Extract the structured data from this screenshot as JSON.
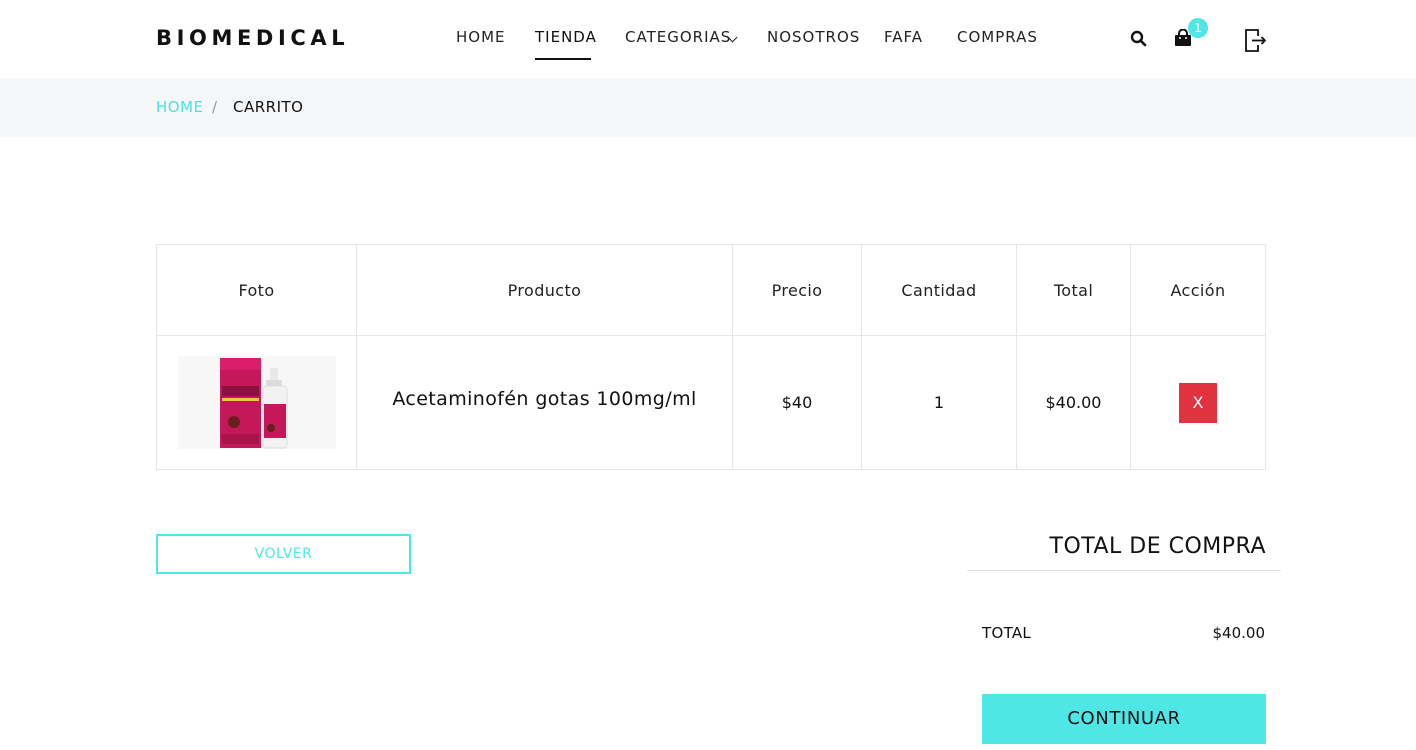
{
  "header": {
    "logo": "BIOMEDICAL",
    "nav": [
      "HOME",
      "TIENDA",
      "CATEGORIAS",
      "NOSOTROS",
      "FAFA",
      "COMPRAS"
    ],
    "active_nav": "TIENDA",
    "cart_count": "1",
    "icons": [
      "search-icon",
      "shopping-bag-icon",
      "logout-icon",
      "chevron-down-icon"
    ]
  },
  "breadcrumb": {
    "home": "HOME",
    "separator": "/",
    "current": "CARRITO"
  },
  "cart_table": {
    "headers": [
      "Foto",
      "Producto",
      "Precio",
      "Cantidad",
      "Total",
      "Acción"
    ],
    "rows": [
      {
        "product": "Acetaminofén gotas 100mg/ml",
        "price": "$40",
        "quantity": "1",
        "total": "$40.00",
        "remove_label": "X"
      }
    ]
  },
  "actions": {
    "back_label": "VOLVER"
  },
  "summary": {
    "title": "TOTAL DE COMPRA",
    "total_label": "TOTAL",
    "total_value": "$40.00",
    "continue_label": "CONTINUAR"
  },
  "colors": {
    "accent": "#4fe6e6",
    "danger": "#e0323f",
    "breadcrumb_bg": "#f6f7f9"
  }
}
